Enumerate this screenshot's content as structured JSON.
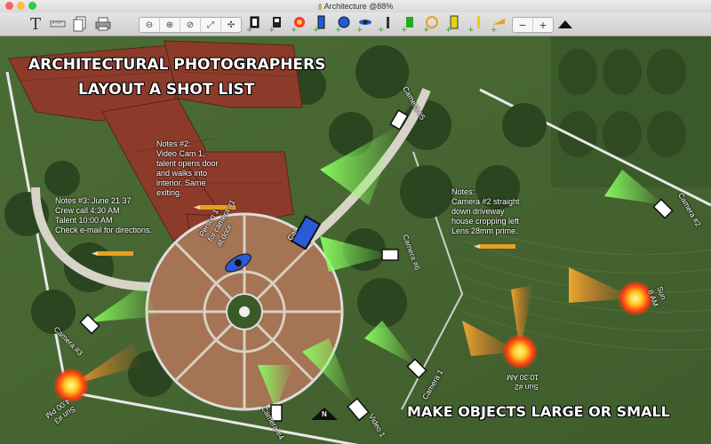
{
  "window": {
    "title": "Architecture @88%"
  },
  "toolbar": {
    "text_tool": "T",
    "minus": "−",
    "plus": "+"
  },
  "canvas": {
    "headline_1": "ARCHITECTURAL PHOTOGRAPHERS",
    "headline_2": "LAYOUT A SHOT LIST",
    "footer_headline": "MAKE OBJECTS LARGE OR SMALL",
    "notes2": "Notes #2:\nVideo Cam 1,\ntalent opens door\nand walks into\ninterior. Same\nexiting.",
    "notes3": "Notes #3: June 21 37\nCrew call 4:30 AM\nTalent 10:00 AM\nCheck e-mail for directions.",
    "notes_main": "Notes:\nCamera #2 straight\ndown driveway\nhouse cropping left\nLens 28mm prime.",
    "person": "Person 1\nfor camera #1\nat door",
    "car": "Car",
    "north": "N",
    "labels": {
      "camera1": "Camera 1",
      "camera2": "Camera #2",
      "camera3": "Camera #3",
      "camera4": "Camera #4",
      "camera5": "Camera #5",
      "camera6": "Camera #6",
      "camera_right": "Camera #2",
      "video1": "Video 1",
      "sun1": "Sun\n8 AM",
      "sun2": "Sun #2\n10:30 AM",
      "sun3": "Sun #3\n4:00 PM"
    }
  },
  "colors": {
    "grass": "#4a6b34",
    "roof": "#8b3a2a",
    "plaza": "#a07050",
    "sun": "#ffcc33",
    "beam": "#7cf25a"
  }
}
